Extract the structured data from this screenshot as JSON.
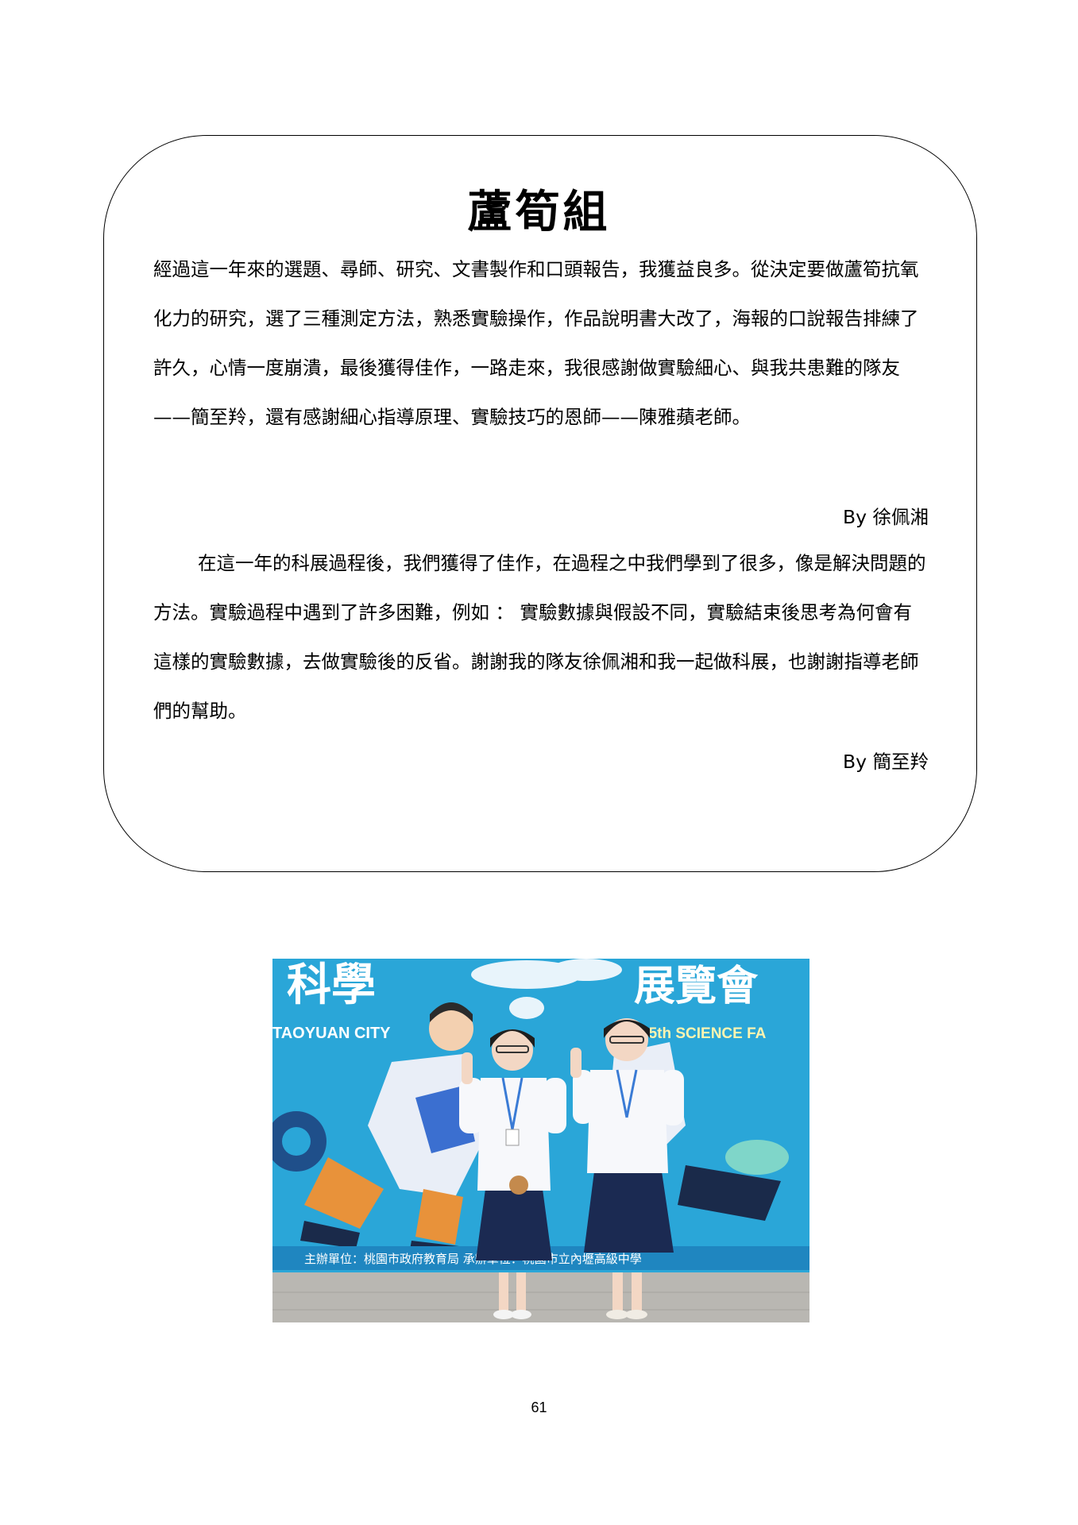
{
  "title": "蘆筍組",
  "reflection_1": {
    "text": "經過這一年來的選題、尋師、研究、文書製作和口頭報告，我獲益良多。從決定要做蘆筍抗氧化力的研究，選了三種測定方法，熟悉實驗操作，作品說明書大改了，海報的口說報告排練了許久，心情一度崩潰，最後獲得佳作，一路走來，我很感謝做實驗細心、與我共患難的隊友——簡至羚，還有感謝細心指導原理、實驗技巧的恩師——陳雅蘋老師。",
    "author": "By 徐佩湘"
  },
  "reflection_2": {
    "text": "在這一年的科展過程後，我們獲得了佳作，在過程之中我們學到了很多，像是解決問題的方法。實驗過程中遇到了許多困難，例如 ： 實驗數據與假設不同，實驗結束後思考為何會有這樣的實驗數據，去做實驗後的反省。謝謝我的隊友徐佩湘和我一起做科展，也謝謝指導老師們的幫助。",
    "author": "By 簡至羚"
  },
  "photo": {
    "banner_text_left": "科學",
    "banner_text_right": "展覽會",
    "banner_sub_left": "TAOYUAN CITY",
    "banner_sub_right": "65th SCIENCE FA",
    "banner_footer": "主辦單位：桃園市政府教育局 承辦單位：桃園市立內壢高級中學",
    "colors": {
      "banner": "#2aa6d8",
      "floor": "#b9b7b2",
      "uniform_skirt": "#1b2a52"
    }
  },
  "page_number": "61"
}
